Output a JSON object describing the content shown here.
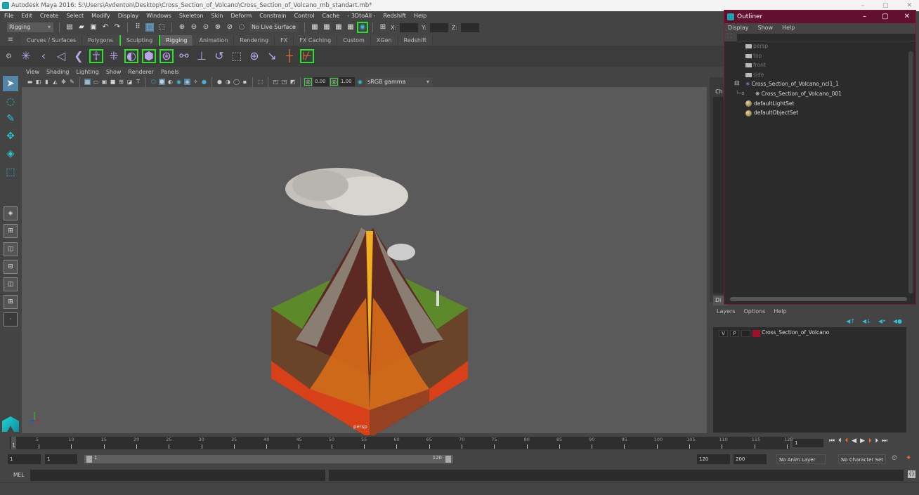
{
  "window": {
    "title": "Autodesk Maya 2016: S:\\Users\\Avdenton\\Desktop\\Cross_Section_of_Volcano\\Cross_Section_of_Volcano_mb_standart.mb*",
    "controls": [
      "–",
      "▢",
      "✕"
    ]
  },
  "menubar": [
    "File",
    "Edit",
    "Create",
    "Select",
    "Modify",
    "Display",
    "Windows",
    "Skeleton",
    "Skin",
    "Deform",
    "Constrain",
    "Control",
    "Cache",
    "- 3DtoAll -",
    "Redshift",
    "Help"
  ],
  "statusline": {
    "menu_set": "Rigging",
    "live_surface": "No Live Surface",
    "x_label": "X:",
    "y_label": "Y:",
    "z_label": "Z:"
  },
  "shelf": {
    "tabs": [
      "Curves / Surfaces",
      "Polygons",
      "Sculpting",
      "Rigging",
      "Animation",
      "Rendering",
      "FX",
      "FX Caching",
      "Custom",
      "XGen",
      "Redshift"
    ],
    "active_tab": "Rigging"
  },
  "panel": {
    "menu": [
      "View",
      "Shading",
      "Lighting",
      "Show",
      "Renderer",
      "Panels"
    ],
    "exposure": "0.00",
    "gamma": "1.00",
    "color_space": "sRGB gamma",
    "camera_label": "persp"
  },
  "channel_box": {
    "tab_label": "Ch",
    "display_tab": "Di"
  },
  "outliner": {
    "title": "Outliner",
    "menu": [
      "Display",
      "Show",
      "Help"
    ],
    "items": [
      {
        "label": "persp",
        "type": "camera",
        "dim": true
      },
      {
        "label": "top",
        "type": "camera",
        "dim": true
      },
      {
        "label": "front",
        "type": "camera",
        "dim": true
      },
      {
        "label": "side",
        "type": "camera",
        "dim": true
      },
      {
        "label": "Cross_Section_of_Volcano_ncl1_1",
        "type": "group",
        "expanded": true
      },
      {
        "label": "Cross_Section_of_Volcano_001",
        "type": "mesh",
        "child": true
      },
      {
        "label": "defaultLightSet",
        "type": "set"
      },
      {
        "label": "defaultObjectSet",
        "type": "set"
      }
    ]
  },
  "layers": {
    "menu": [
      "Layers",
      "Options",
      "Help"
    ],
    "items": [
      {
        "v": "V",
        "p": "P",
        "name": "Cross_Section_of_Volcano",
        "color": "#a0102a"
      }
    ]
  },
  "timeline": {
    "ticks": [
      5,
      10,
      15,
      20,
      25,
      30,
      35,
      40,
      45,
      50,
      55,
      60,
      65,
      70,
      75,
      80,
      85,
      90,
      95,
      100,
      105,
      110,
      115,
      120
    ],
    "current_frame": "1",
    "start_marker": "1"
  },
  "range": {
    "start": "1",
    "playback_start": "1",
    "slider_start": "1",
    "slider_end": "120",
    "playback_end": "120",
    "end": "200",
    "anim_layer": "No Anim Layer",
    "character_set": "No Character Set"
  },
  "mel": {
    "label": "MEL"
  }
}
